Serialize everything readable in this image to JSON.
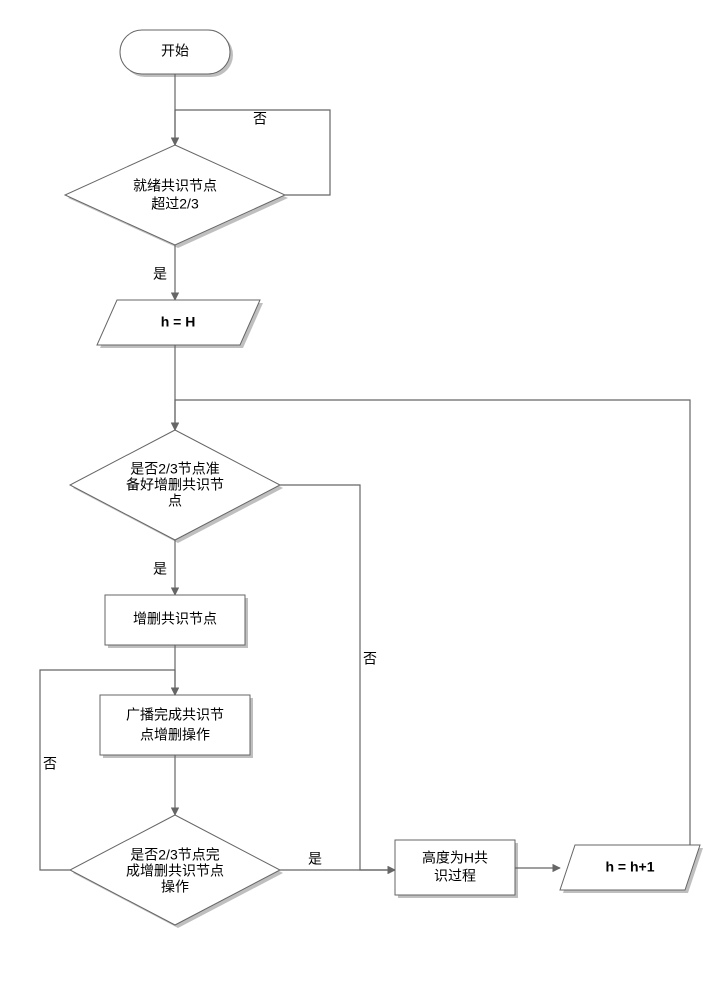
{
  "chart_data": {
    "type": "flowchart",
    "nodes": [
      {
        "id": "start",
        "shape": "terminator",
        "label": "开始"
      },
      {
        "id": "d1",
        "shape": "decision",
        "label": "就绪共识节点超过2/3"
      },
      {
        "id": "io1",
        "shape": "parallelogram",
        "label": "h = H"
      },
      {
        "id": "d2",
        "shape": "decision",
        "label": "是否2/3节点准备好增删共识节点"
      },
      {
        "id": "p1",
        "shape": "process",
        "label": "增删共识节点"
      },
      {
        "id": "p2",
        "shape": "process",
        "label": "广播完成共识节点增删操作"
      },
      {
        "id": "d3",
        "shape": "decision",
        "label": "是否2/3节点完成增删共识节点操作"
      },
      {
        "id": "p3",
        "shape": "process",
        "label": "高度为H共识过程"
      },
      {
        "id": "io2",
        "shape": "parallelogram",
        "label": "h = h+1"
      }
    ],
    "edges": [
      {
        "from": "start",
        "to": "d1",
        "label": ""
      },
      {
        "from": "d1",
        "to": "d1",
        "label": "否",
        "loop": true
      },
      {
        "from": "d1",
        "to": "io1",
        "label": "是"
      },
      {
        "from": "io1",
        "to": "d2",
        "label": ""
      },
      {
        "from": "d2",
        "to": "p1",
        "label": "是"
      },
      {
        "from": "d2",
        "to": "p3",
        "label": "否"
      },
      {
        "from": "p1",
        "to": "p2",
        "label": ""
      },
      {
        "from": "p2",
        "to": "d3",
        "label": ""
      },
      {
        "from": "d3",
        "to": "p2",
        "label": "否",
        "loop": true
      },
      {
        "from": "d3",
        "to": "p3",
        "label": "是"
      },
      {
        "from": "p3",
        "to": "io2",
        "label": ""
      },
      {
        "from": "io2",
        "to": "d2",
        "label": "",
        "back": true
      }
    ]
  },
  "labels": {
    "start": "开始",
    "d1_l1": "就绪共识节点",
    "d1_l2": "超过2/3",
    "io1": "h = H",
    "d2_l1": "是否2/3节点准",
    "d2_l2": "备好增删共识节",
    "d2_l3": "点",
    "p1": "增删共识节点",
    "p2_l1": "广播完成共识节",
    "p2_l2": "点增删操作",
    "d3_l1": "是否2/3节点完",
    "d3_l2": "成增删共识节点",
    "d3_l3": "操作",
    "p3_l1": "高度为H共",
    "p3_l2": "识过程",
    "io2": "h = h+1",
    "yes": "是",
    "no": "否"
  }
}
